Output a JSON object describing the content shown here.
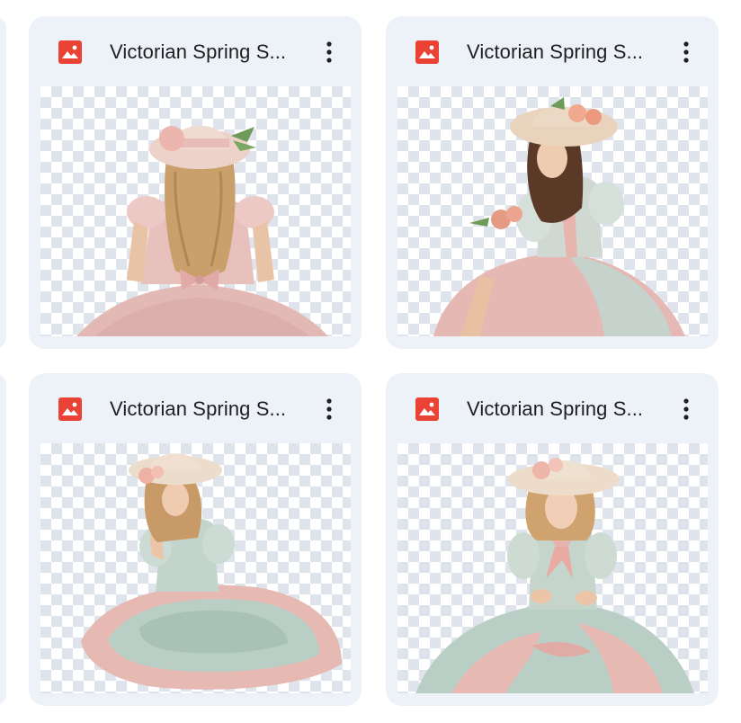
{
  "cards": [
    {
      "title": "Victorian Spring S...",
      "file_icon": "image-file-icon",
      "menu_icon": "more-vert-icon",
      "thumb": "woman-back-pink-dress-hat"
    },
    {
      "title": "Victorian Spring S...",
      "file_icon": "image-file-icon",
      "menu_icon": "more-vert-icon",
      "thumb": "woman-sitting-hat-roses"
    },
    {
      "title": "Victorian Spring S...",
      "file_icon": "image-file-icon",
      "menu_icon": "more-vert-icon",
      "thumb": "woman-sitting-mint-ruffled-dress"
    },
    {
      "title": "Victorian Spring S...",
      "file_icon": "image-file-icon",
      "menu_icon": "more-vert-icon",
      "thumb": "girl-sitting-floral-dress"
    }
  ],
  "colors": {
    "card_bg": "#edf1f8",
    "icon_red": "#ea4335",
    "text": "#1f1f1f",
    "dress_pink": "#e6b9b4",
    "dress_mint": "#b9cfc6",
    "hat": "#efd9c6"
  }
}
